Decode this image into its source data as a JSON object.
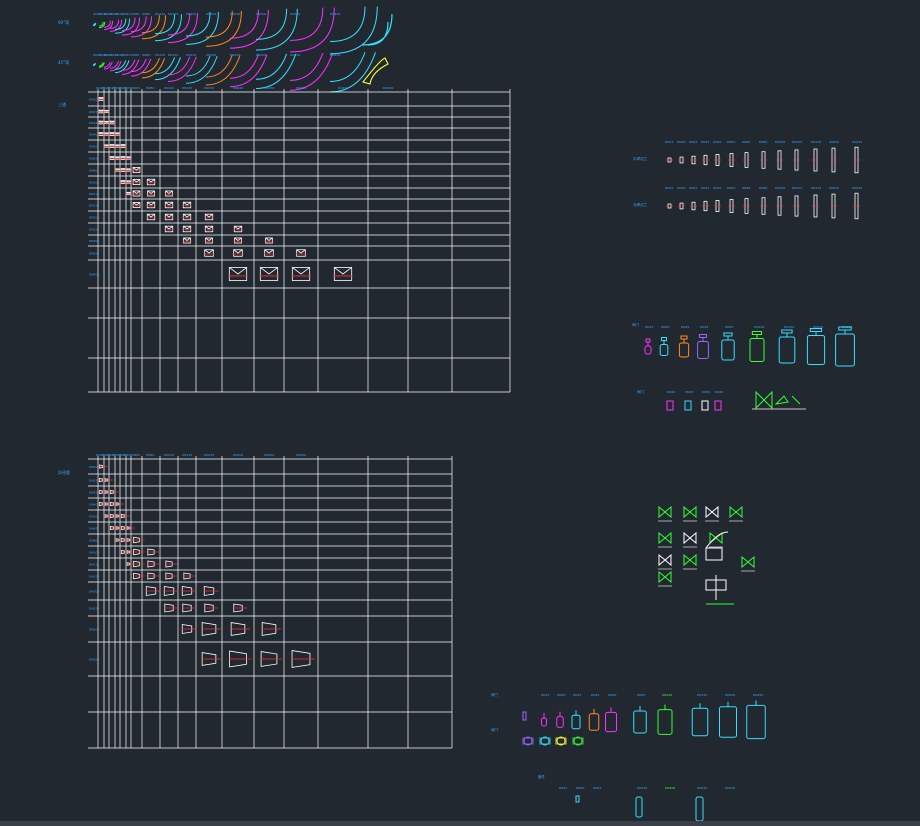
{
  "colors": {
    "background": "#212830",
    "grid": "#ffffff",
    "label": "#37a6ff",
    "red": "#ff3030",
    "magenta": "#ff30ff",
    "orange": "#ff8c1a",
    "cyan": "#33e0ff",
    "green": "#33ff33",
    "yellow": "#ffff33",
    "purple": "#9966ff",
    "status_bar": "#3a4048"
  },
  "elbow_rows": {
    "row1_label": "90°弯",
    "row2_label": "45°弯",
    "sizes": [
      "DN15",
      "DN20",
      "DN25",
      "DN32",
      "DN40",
      "DN50",
      "DN65",
      "DN80",
      "DN100",
      "DN125",
      "DN150",
      "DN200",
      "DN250",
      "DN300",
      "DN350",
      "DN400"
    ]
  },
  "tee_table": {
    "corner_label": "三通",
    "columns": [
      "DN15",
      "DN20",
      "DN25",
      "DN32",
      "DN40",
      "DN50",
      "DN65",
      "DN80",
      "DN100",
      "DN125",
      "DN150",
      "DN200",
      "DN250",
      "DN300",
      "DN350",
      "DN400"
    ],
    "rows": [
      "DN20",
      "DN25",
      "DN32",
      "DN40",
      "DN50",
      "DN65",
      "DN80",
      "DN100",
      "DN125",
      "DN150",
      "DN200",
      "DN250",
      "DN300",
      "DN350",
      "DN400"
    ]
  },
  "reducer_table": {
    "corner_label": "异径管",
    "columns": [
      "DN15",
      "DN20",
      "DN25",
      "DN32",
      "DN40",
      "DN50",
      "DN65",
      "DN80",
      "DN100",
      "DN125",
      "DN150",
      "DN200",
      "DN250",
      "DN300"
    ],
    "rows": [
      "DN20",
      "DN25",
      "DN32",
      "DN40",
      "DN50",
      "DN65",
      "DN80",
      "DN100",
      "DN125",
      "DN150",
      "DN200",
      "DN250",
      "DN300",
      "DN350"
    ]
  },
  "flange_rows": {
    "row1_label": "平焊法兰",
    "row2_label": "对焊法兰",
    "sizes": [
      "DN15",
      "DN20",
      "DN25",
      "DN32",
      "DN40",
      "DN50",
      "DN65",
      "DN80",
      "DN100",
      "DN125",
      "DN150",
      "DN200",
      "DN250",
      "DN300"
    ]
  },
  "valve_group": {
    "row1_label": "阀门",
    "row1_sizes": [
      "DN15",
      "DN20",
      "DN25",
      "DN32",
      "DN50",
      "DN100",
      "DN150",
      "DN200",
      "DN250"
    ],
    "row2_label": "阀门",
    "row2_sizes": [
      "DN20",
      "DN25",
      "DN32",
      "DN40"
    ]
  },
  "bottom_group": {
    "row1_label": "阀门",
    "row1_sizes": [
      "DN15",
      "DN20",
      "DN25",
      "DN32",
      "DN40",
      "DN50",
      "DN100",
      "DN150",
      "DN200",
      "DN250"
    ],
    "row2_label": "阀门",
    "row3_label": "管件",
    "row3_sizes": [
      "DN15",
      "DN20",
      "DN25",
      "DN150",
      "DN200",
      "DN250",
      "DN300"
    ]
  }
}
